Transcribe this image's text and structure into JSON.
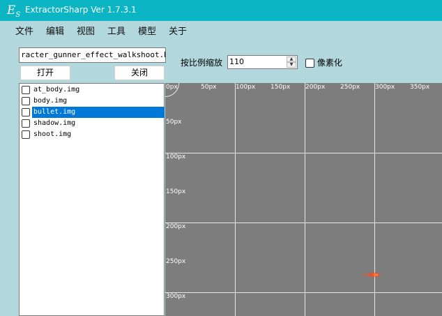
{
  "window": {
    "title": "ExtractorSharp Ver 1.7.3.1",
    "icon": "es-logo-icon",
    "accent_color": "#0bb5c4",
    "background_color": "#b2d7dd"
  },
  "menu": [
    "文件",
    "编辑",
    "视图",
    "工具",
    "模型",
    "关于"
  ],
  "file_path": "racter_gunner_effect_walkshoot.NPK",
  "buttons": {
    "open": "打开",
    "close": "关闭"
  },
  "scale": {
    "label": "按比例缩放",
    "value": "110"
  },
  "pixelate": {
    "label": "像素化",
    "checked": false
  },
  "file_list": [
    {
      "name": "at_body.img",
      "checked": false,
      "selected": false
    },
    {
      "name": "body.img",
      "checked": false,
      "selected": false
    },
    {
      "name": "bullet.img",
      "checked": false,
      "selected": true
    },
    {
      "name": "shadow.img",
      "checked": false,
      "selected": false
    },
    {
      "name": "shoot.img",
      "checked": false,
      "selected": false
    }
  ],
  "canvas": {
    "x_labels": [
      "0px",
      "50px",
      "100px",
      "150px",
      "200px",
      "250px",
      "300px",
      "350px"
    ],
    "y_labels": [
      "50px",
      "100px",
      "150px",
      "200px",
      "250px",
      "300px"
    ],
    "background_color": "#7d7d7d",
    "grid_color": "#e8e8e8",
    "sprite_color": "#ff4a1a"
  }
}
